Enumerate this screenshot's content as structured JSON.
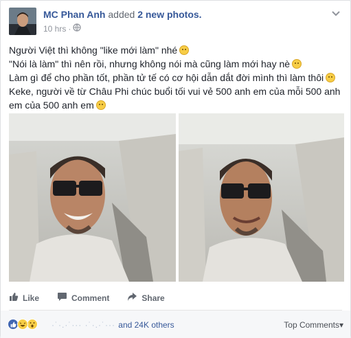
{
  "header": {
    "author": "MC Phan Anh",
    "action": "added",
    "action_count": "2 new photos.",
    "timestamp": "10 hrs",
    "separator": "·",
    "privacy_icon": "globe-icon",
    "options_icon": "chevron-down-icon"
  },
  "post": {
    "lines": [
      "Người Việt thì không \"like mới làm\" nhé",
      "\"Nói là làm\" thì nên rồi, nhưng không nói mà cũng làm mới hay nè",
      "Làm gì để cho phần tốt, phần tử tế có cơ hội dẫn dắt đời mình thì làm thôi",
      "Keke, người về từ Châu Phi chúc buổi tối vui vẻ 500 anh em của mỗi 500 anh",
      "em của 500 anh em"
    ]
  },
  "actions": {
    "like": "Like",
    "comment": "Comment",
    "share": "Share"
  },
  "reactions": {
    "icons": [
      "like-icon",
      "haha-icon",
      "wow-icon"
    ],
    "summary": "and 24K others",
    "sort_label": "Top Comments"
  },
  "colors": {
    "link": "#365899",
    "meta": "#90949c",
    "like_blue": "#4267b2"
  }
}
